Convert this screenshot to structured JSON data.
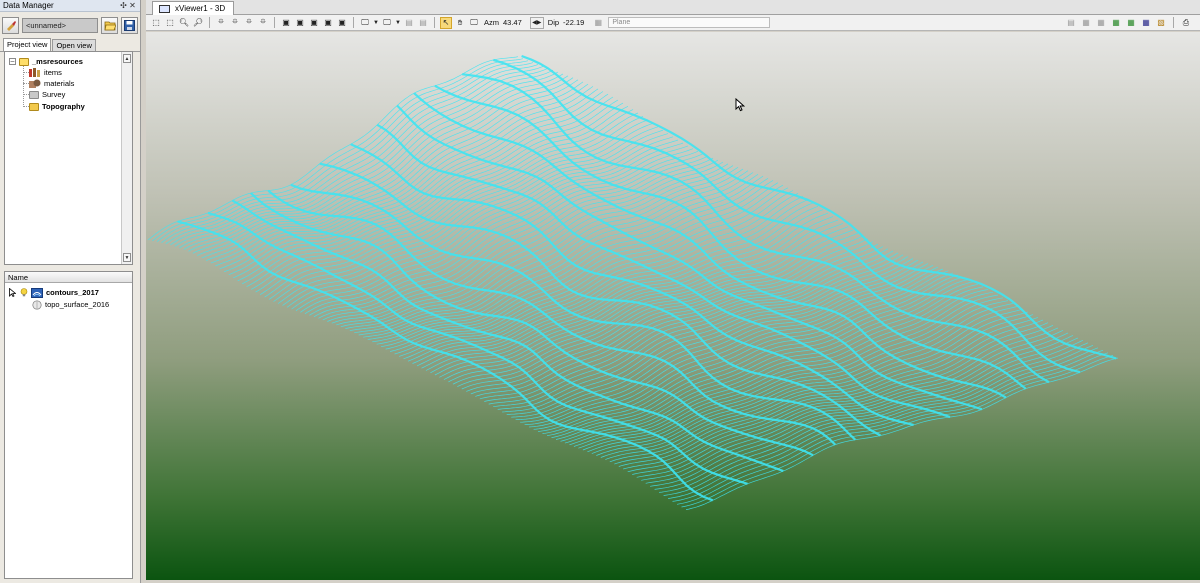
{
  "data_manager": {
    "title": "Data Manager",
    "project_combo": "<unnamed>",
    "tabs": [
      "Project view",
      "Open view"
    ],
    "tree": {
      "root": "_msresources",
      "children": [
        "items",
        "materials",
        "Survey",
        "Topography"
      ]
    },
    "list": {
      "column": "Name",
      "items": [
        "contours_2017",
        "topo_surface_2016"
      ]
    }
  },
  "viewer": {
    "tab_title": "xViewer1 - 3D",
    "azm_label": "Azm",
    "azm_value": "43.47",
    "dip_label": "Dip",
    "dip_value": "-22.19",
    "plane_placeholder": "Plane"
  },
  "colors": {
    "contour": "#3ee4f2",
    "sky_top": "#e6e6e4",
    "ground_bottom": "#0b5410",
    "highlight_tool": "#f7d97a"
  },
  "icons": [
    "pin-icon",
    "close-icon",
    "picker-icon",
    "open-folder-icon",
    "save-icon",
    "zoom-icon",
    "select-icon",
    "monitor-icon",
    "print-icon",
    "grid-icon"
  ]
}
